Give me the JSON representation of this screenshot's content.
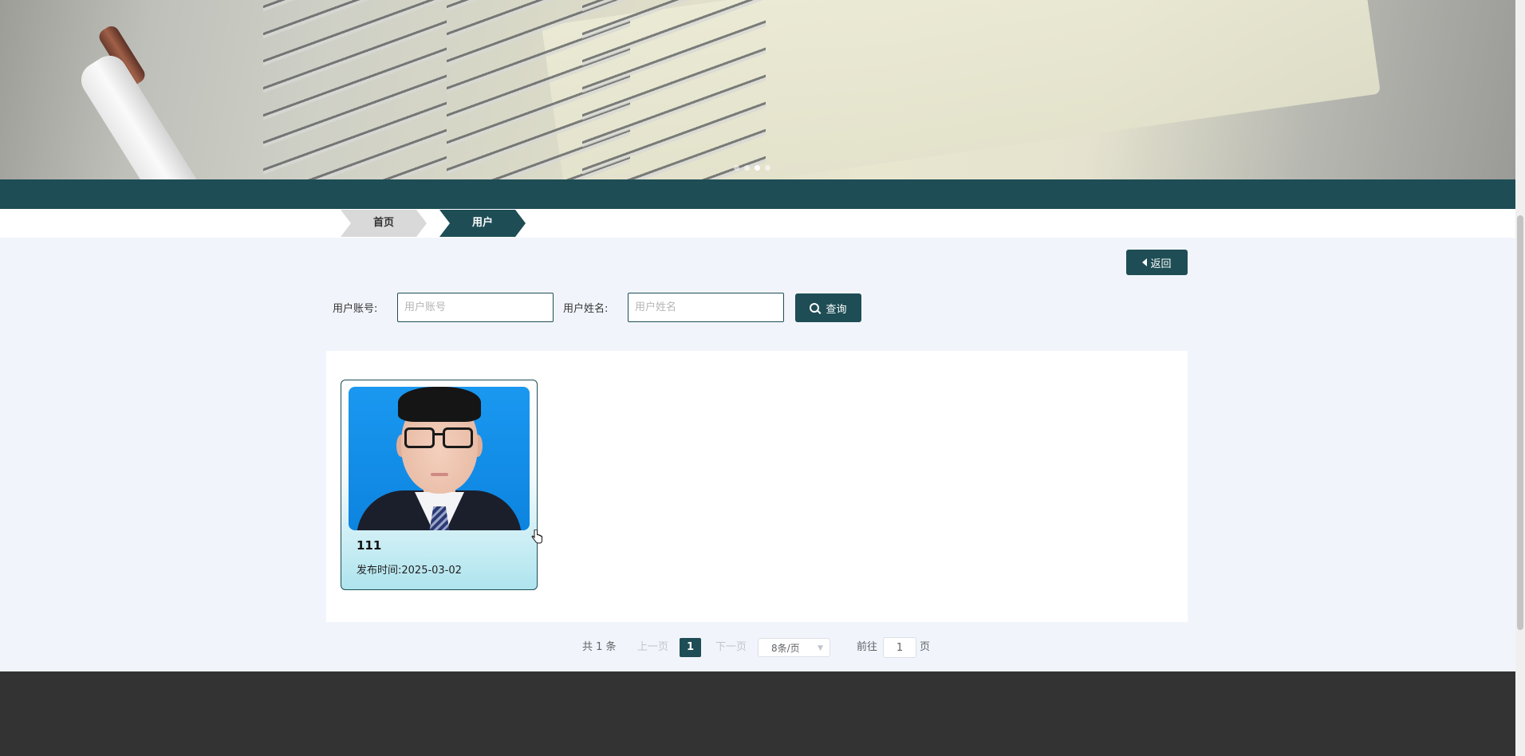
{
  "banner": {
    "slides": 4,
    "active_slide": 3
  },
  "breadcrumb": {
    "home": "首页",
    "current": "用户"
  },
  "actions": {
    "back_label": "返回"
  },
  "search": {
    "account_label": "用户账号:",
    "account_placeholder": "用户账号",
    "account_value": "",
    "name_label": "用户姓名:",
    "name_placeholder": "用户姓名",
    "name_value": "",
    "query_label": "查询"
  },
  "cards": [
    {
      "title": "111",
      "date_label": "发布时间:",
      "date": "2025-03-02"
    }
  ],
  "pagination": {
    "total_text": "共 1 条",
    "prev_label": "上一页",
    "current_page": "1",
    "next_label": "下一页",
    "page_size": "8条/页",
    "goto_label": "前往",
    "goto_value": "1",
    "goto_unit": "页"
  },
  "colors": {
    "primary": "#1e4d55",
    "footer": "#333333",
    "background": "#f1f5fb"
  }
}
